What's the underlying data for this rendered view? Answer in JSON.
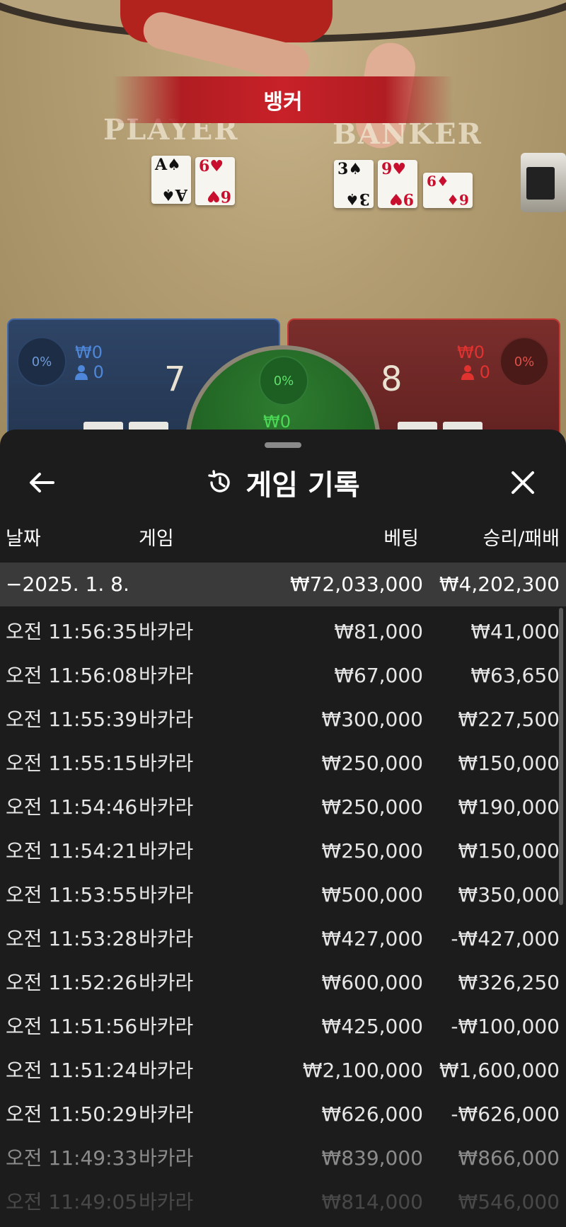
{
  "table": {
    "banner": "뱅커",
    "player_label": "PLAYER",
    "banker_label": "BANKER",
    "player_cards": [
      {
        "rank": "A",
        "suit": "♠",
        "color": "black"
      },
      {
        "rank": "6",
        "suit": "♥",
        "color": "red"
      }
    ],
    "banker_cards": [
      {
        "rank": "3",
        "suit": "♠",
        "color": "black"
      },
      {
        "rank": "9",
        "suit": "♥",
        "color": "red"
      },
      {
        "rank": "6",
        "suit": "♦",
        "color": "red"
      }
    ]
  },
  "betting": {
    "player": {
      "pct": "0%",
      "amount": "₩0",
      "users": "0",
      "score": "7",
      "color": "#4e86d9"
    },
    "tie": {
      "pct": "0%",
      "amount": "₩0",
      "color": "#4bd955"
    },
    "banker": {
      "pct": "0%",
      "amount": "₩0",
      "users": "0",
      "score": "8",
      "color": "#e0322f"
    }
  },
  "history": {
    "title": "게임 기록",
    "columns": {
      "date": "날짜",
      "game": "게임",
      "bet": "베팅",
      "result": "승리/패배"
    },
    "summary": {
      "date": "−2025. 1. 8.",
      "bet": "₩72,033,000",
      "result": "₩4,202,300"
    },
    "rows": [
      {
        "time": "오전 11:56:35",
        "game": "바카라",
        "bet": "₩81,000",
        "result": "₩41,000"
      },
      {
        "time": "오전 11:56:08",
        "game": "바카라",
        "bet": "₩67,000",
        "result": "₩63,650"
      },
      {
        "time": "오전 11:55:39",
        "game": "바카라",
        "bet": "₩300,000",
        "result": "₩227,500"
      },
      {
        "time": "오전 11:55:15",
        "game": "바카라",
        "bet": "₩250,000",
        "result": "₩150,000"
      },
      {
        "time": "오전 11:54:46",
        "game": "바카라",
        "bet": "₩250,000",
        "result": "₩190,000"
      },
      {
        "time": "오전 11:54:21",
        "game": "바카라",
        "bet": "₩250,000",
        "result": "₩150,000"
      },
      {
        "time": "오전 11:53:55",
        "game": "바카라",
        "bet": "₩500,000",
        "result": "₩350,000"
      },
      {
        "time": "오전 11:53:28",
        "game": "바카라",
        "bet": "₩427,000",
        "result": "-₩427,000"
      },
      {
        "time": "오전 11:52:26",
        "game": "바카라",
        "bet": "₩600,000",
        "result": "₩326,250"
      },
      {
        "time": "오전 11:51:56",
        "game": "바카라",
        "bet": "₩425,000",
        "result": "-₩100,000"
      },
      {
        "time": "오전 11:51:24",
        "game": "바카라",
        "bet": "₩2,100,000",
        "result": "₩1,600,000"
      },
      {
        "time": "오전 11:50:29",
        "game": "바카라",
        "bet": "₩626,000",
        "result": "-₩626,000"
      },
      {
        "time": "오전 11:49:33",
        "game": "바카라",
        "bet": "₩839,000",
        "result": "₩866,000"
      },
      {
        "time": "오전 11:49:05",
        "game": "바카라",
        "bet": "₩814,000",
        "result": "₩546,000"
      }
    ]
  },
  "icons": {
    "back": "arrow-left-icon",
    "history": "history-clock-icon",
    "close": "close-icon",
    "user": "user-icon"
  }
}
